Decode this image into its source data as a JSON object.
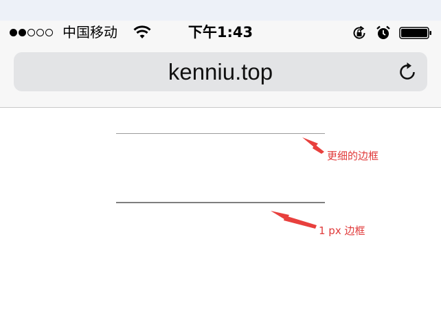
{
  "status_bar": {
    "signal_icon": "signal-dots-icon",
    "carrier": "中国移动",
    "wifi_icon": "wifi-icon",
    "time": "下午1:43",
    "rotation_lock_icon": "rotation-lock-icon",
    "alarm_icon": "alarm-icon",
    "battery_icon": "battery-icon"
  },
  "browser": {
    "url": "kenniu.top",
    "reload_icon": "reload-icon"
  },
  "content": {
    "annotation_thin": "更细的边框",
    "annotation_1px": "1 px 边框",
    "annotation_color": "#e03a3a"
  }
}
